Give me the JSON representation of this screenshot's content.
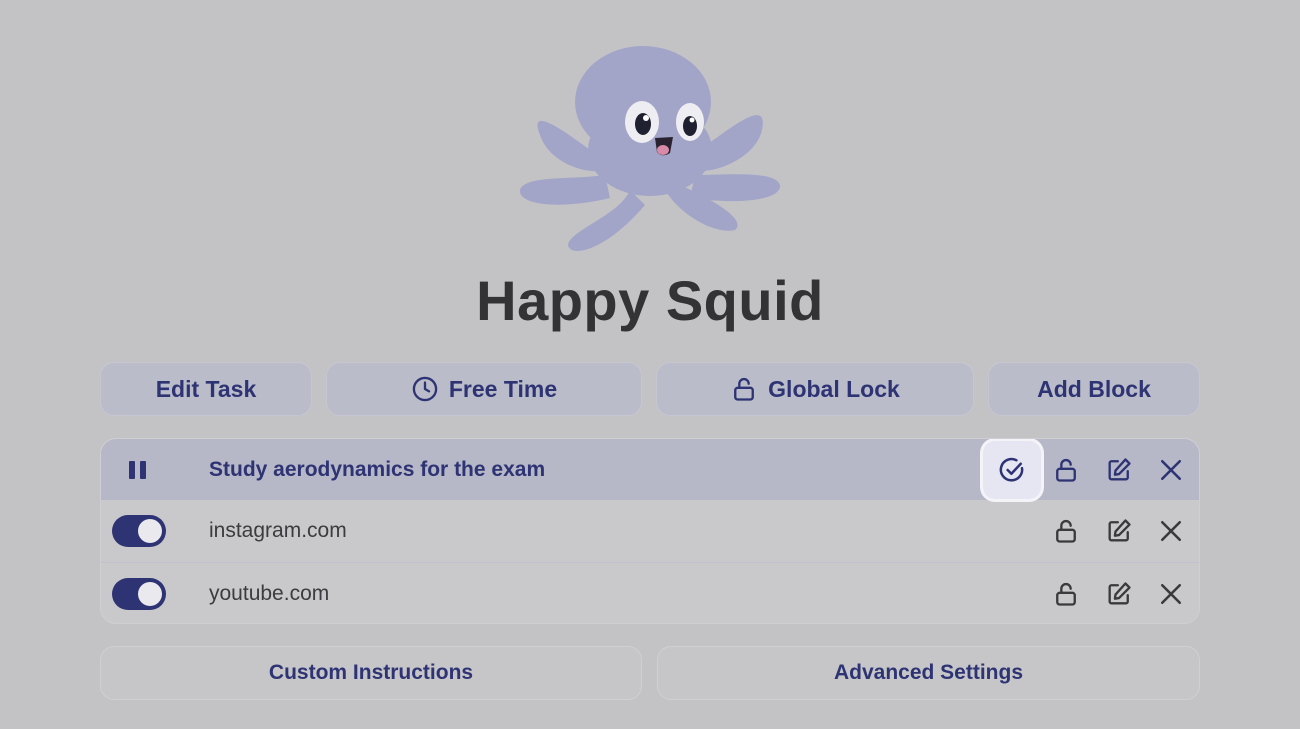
{
  "app": {
    "title": "Happy Squid"
  },
  "toolbar": {
    "edit_task": "Edit Task",
    "free_time": "Free Time",
    "global_lock": "Global Lock",
    "add_block": "Add Block"
  },
  "task": {
    "label": "Study aerodynamics for the exam"
  },
  "blocks": [
    {
      "site": "instagram.com",
      "enabled": true
    },
    {
      "site": "youtube.com",
      "enabled": true
    }
  ],
  "footer": {
    "custom_instructions": "Custom Instructions",
    "advanced_settings": "Advanced Settings"
  },
  "icons": {
    "free_time": "clock-icon",
    "global_lock": "lock-icon",
    "task_state": "pause-icon",
    "task_complete": "check-circle-icon",
    "lock": "unlock-icon",
    "edit": "edit-icon",
    "delete": "close-icon"
  },
  "colors": {
    "background": "#c3c3c6",
    "accent": "#2e3374",
    "mascot": "#a2a5c8",
    "button_bg": "#bbbcc9"
  }
}
